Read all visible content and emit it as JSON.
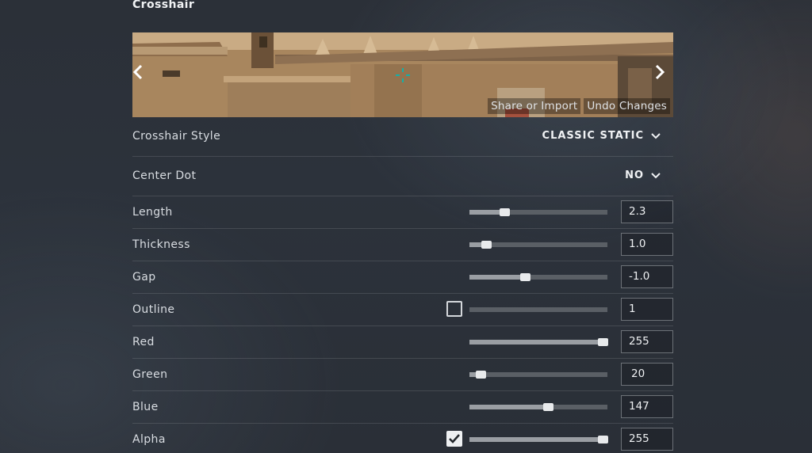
{
  "section": {
    "title": "Crosshair"
  },
  "preview": {
    "share_label": "Share or Import",
    "undo_label": "Undo Changes",
    "crosshair_color": "#00a0a0"
  },
  "settings": {
    "style": {
      "label": "Crosshair Style",
      "value": "CLASSIC STATIC"
    },
    "center_dot": {
      "label": "Center Dot",
      "value": "NO"
    },
    "length": {
      "label": "Length",
      "value": "2.3",
      "slider_fraction": 0.25
    },
    "thickness": {
      "label": "Thickness",
      "value": "1.0",
      "slider_fraction": 0.12
    },
    "gap": {
      "label": "Gap",
      "value": "-1.0",
      "slider_fraction": 0.4
    },
    "outline": {
      "label": "Outline",
      "value": "1",
      "slider_fraction": 0.0,
      "checked": false
    },
    "red": {
      "label": "Red",
      "value": "255",
      "slider_fraction": 1.0
    },
    "green": {
      "label": "Green",
      "value": "20",
      "slider_fraction": 0.08
    },
    "blue": {
      "label": "Blue",
      "value": "147",
      "slider_fraction": 0.57
    },
    "alpha": {
      "label": "Alpha",
      "value": "255",
      "slider_fraction": 1.0,
      "checked": true
    }
  }
}
